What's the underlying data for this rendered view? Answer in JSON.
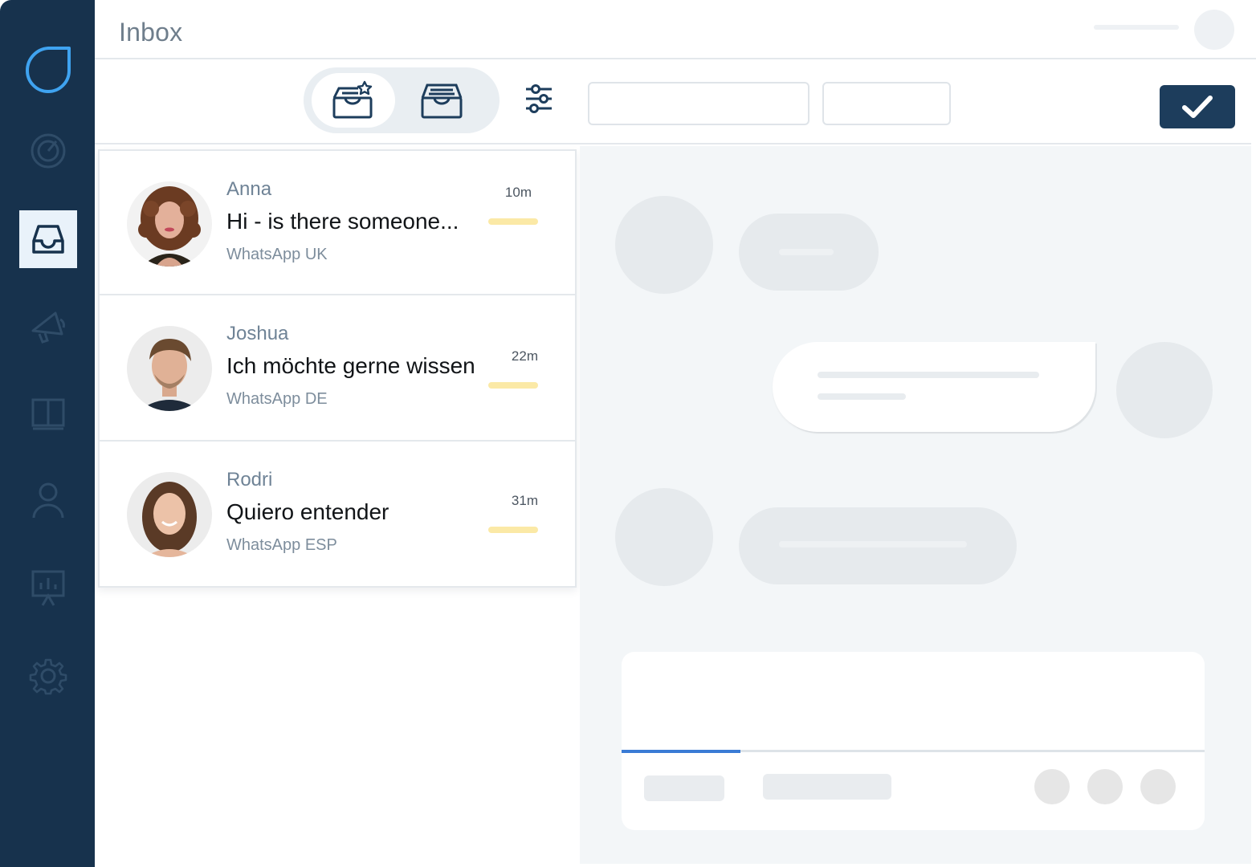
{
  "header": {
    "title": "Inbox"
  },
  "sidebar": {
    "items": [
      {
        "icon": "logo-icon"
      },
      {
        "icon": "dashboard-gauge-icon"
      },
      {
        "icon": "inbox-icon",
        "active": true
      },
      {
        "icon": "megaphone-icon"
      },
      {
        "icon": "book-icon"
      },
      {
        "icon": "user-icon"
      },
      {
        "icon": "presentation-chart-icon"
      },
      {
        "icon": "gear-icon"
      }
    ]
  },
  "toolbar": {
    "tabs": [
      {
        "icon": "starred-inbox-icon",
        "active": true
      },
      {
        "icon": "inbox-tray-icon",
        "active": false
      }
    ],
    "filter_icon": "sliders-icon",
    "confirm_icon": "checkmark-icon",
    "accent_color": "#1d3d5c"
  },
  "conversations": [
    {
      "name": "Anna",
      "message": "Hi - is there someone...",
      "channel": "WhatsApp UK",
      "time": "10m"
    },
    {
      "name": "Joshua",
      "message": "Ich möchte gerne wissen",
      "channel": "WhatsApp DE",
      "time": "22m"
    },
    {
      "name": "Rodri",
      "message": "Quiero entender",
      "channel": "WhatsApp ESP",
      "time": "31m"
    }
  ],
  "colors": {
    "sidebar": "#17324d",
    "unread_bar": "#fbe9a6",
    "composer_progress": "#3a7bd5"
  }
}
